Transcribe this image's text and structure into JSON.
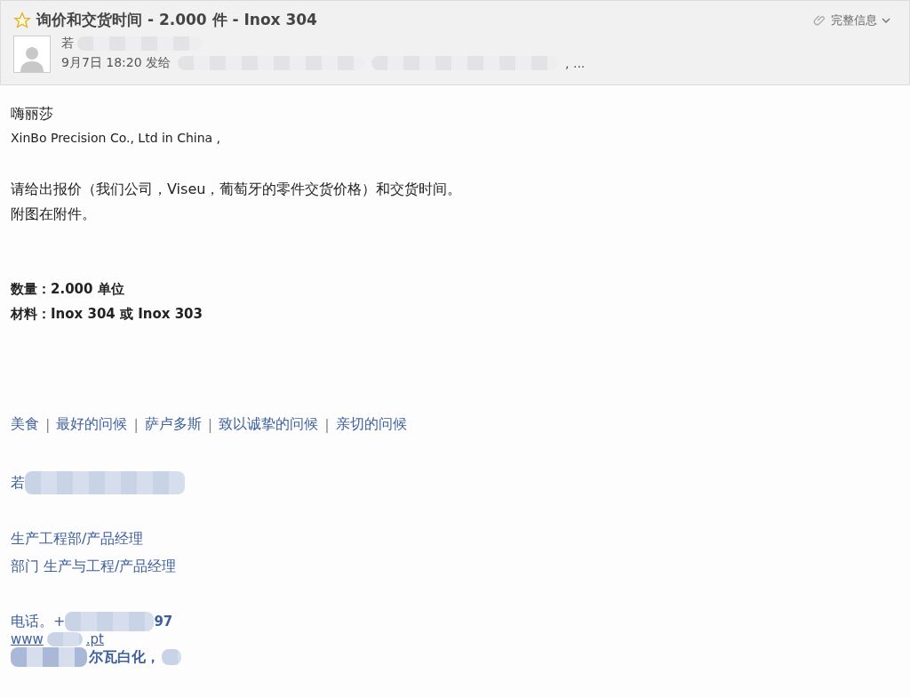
{
  "header": {
    "starred": false,
    "title": "询价和交货时间 - 2.000 件 - Inox 304",
    "details_link": "完整信息",
    "sender": "若",
    "time_sent": "9月7日 18:20 发给",
    "recipients_tail": ", ..."
  },
  "body": {
    "greeting": "嗨丽莎",
    "addressee": "XinBo Precision Co., Ltd in China ,",
    "paragraphs": [
      "请给出报价（我们公司，Viseu，葡萄牙的零件交货价格）和交货时间。",
      "附图在附件。"
    ],
    "specs": [
      "数量：2.000 单位",
      "材料：Inox 304 或 Inox 303"
    ]
  },
  "signature": {
    "separator": "|",
    "salutations": [
      "美食",
      "最好的问候",
      "萨卢多斯",
      "致以诚挚的问候",
      "亲切的问候"
    ],
    "name_start": "若",
    "roles": [
      "生产工程部/产品经理",
      "部门 生产与工程/产品经理"
    ],
    "phone_label": "电话。+",
    "phone_end": "97",
    "web_start": "www",
    "web_end": ".pt",
    "address_fragment": "尔瓦白化，"
  }
}
